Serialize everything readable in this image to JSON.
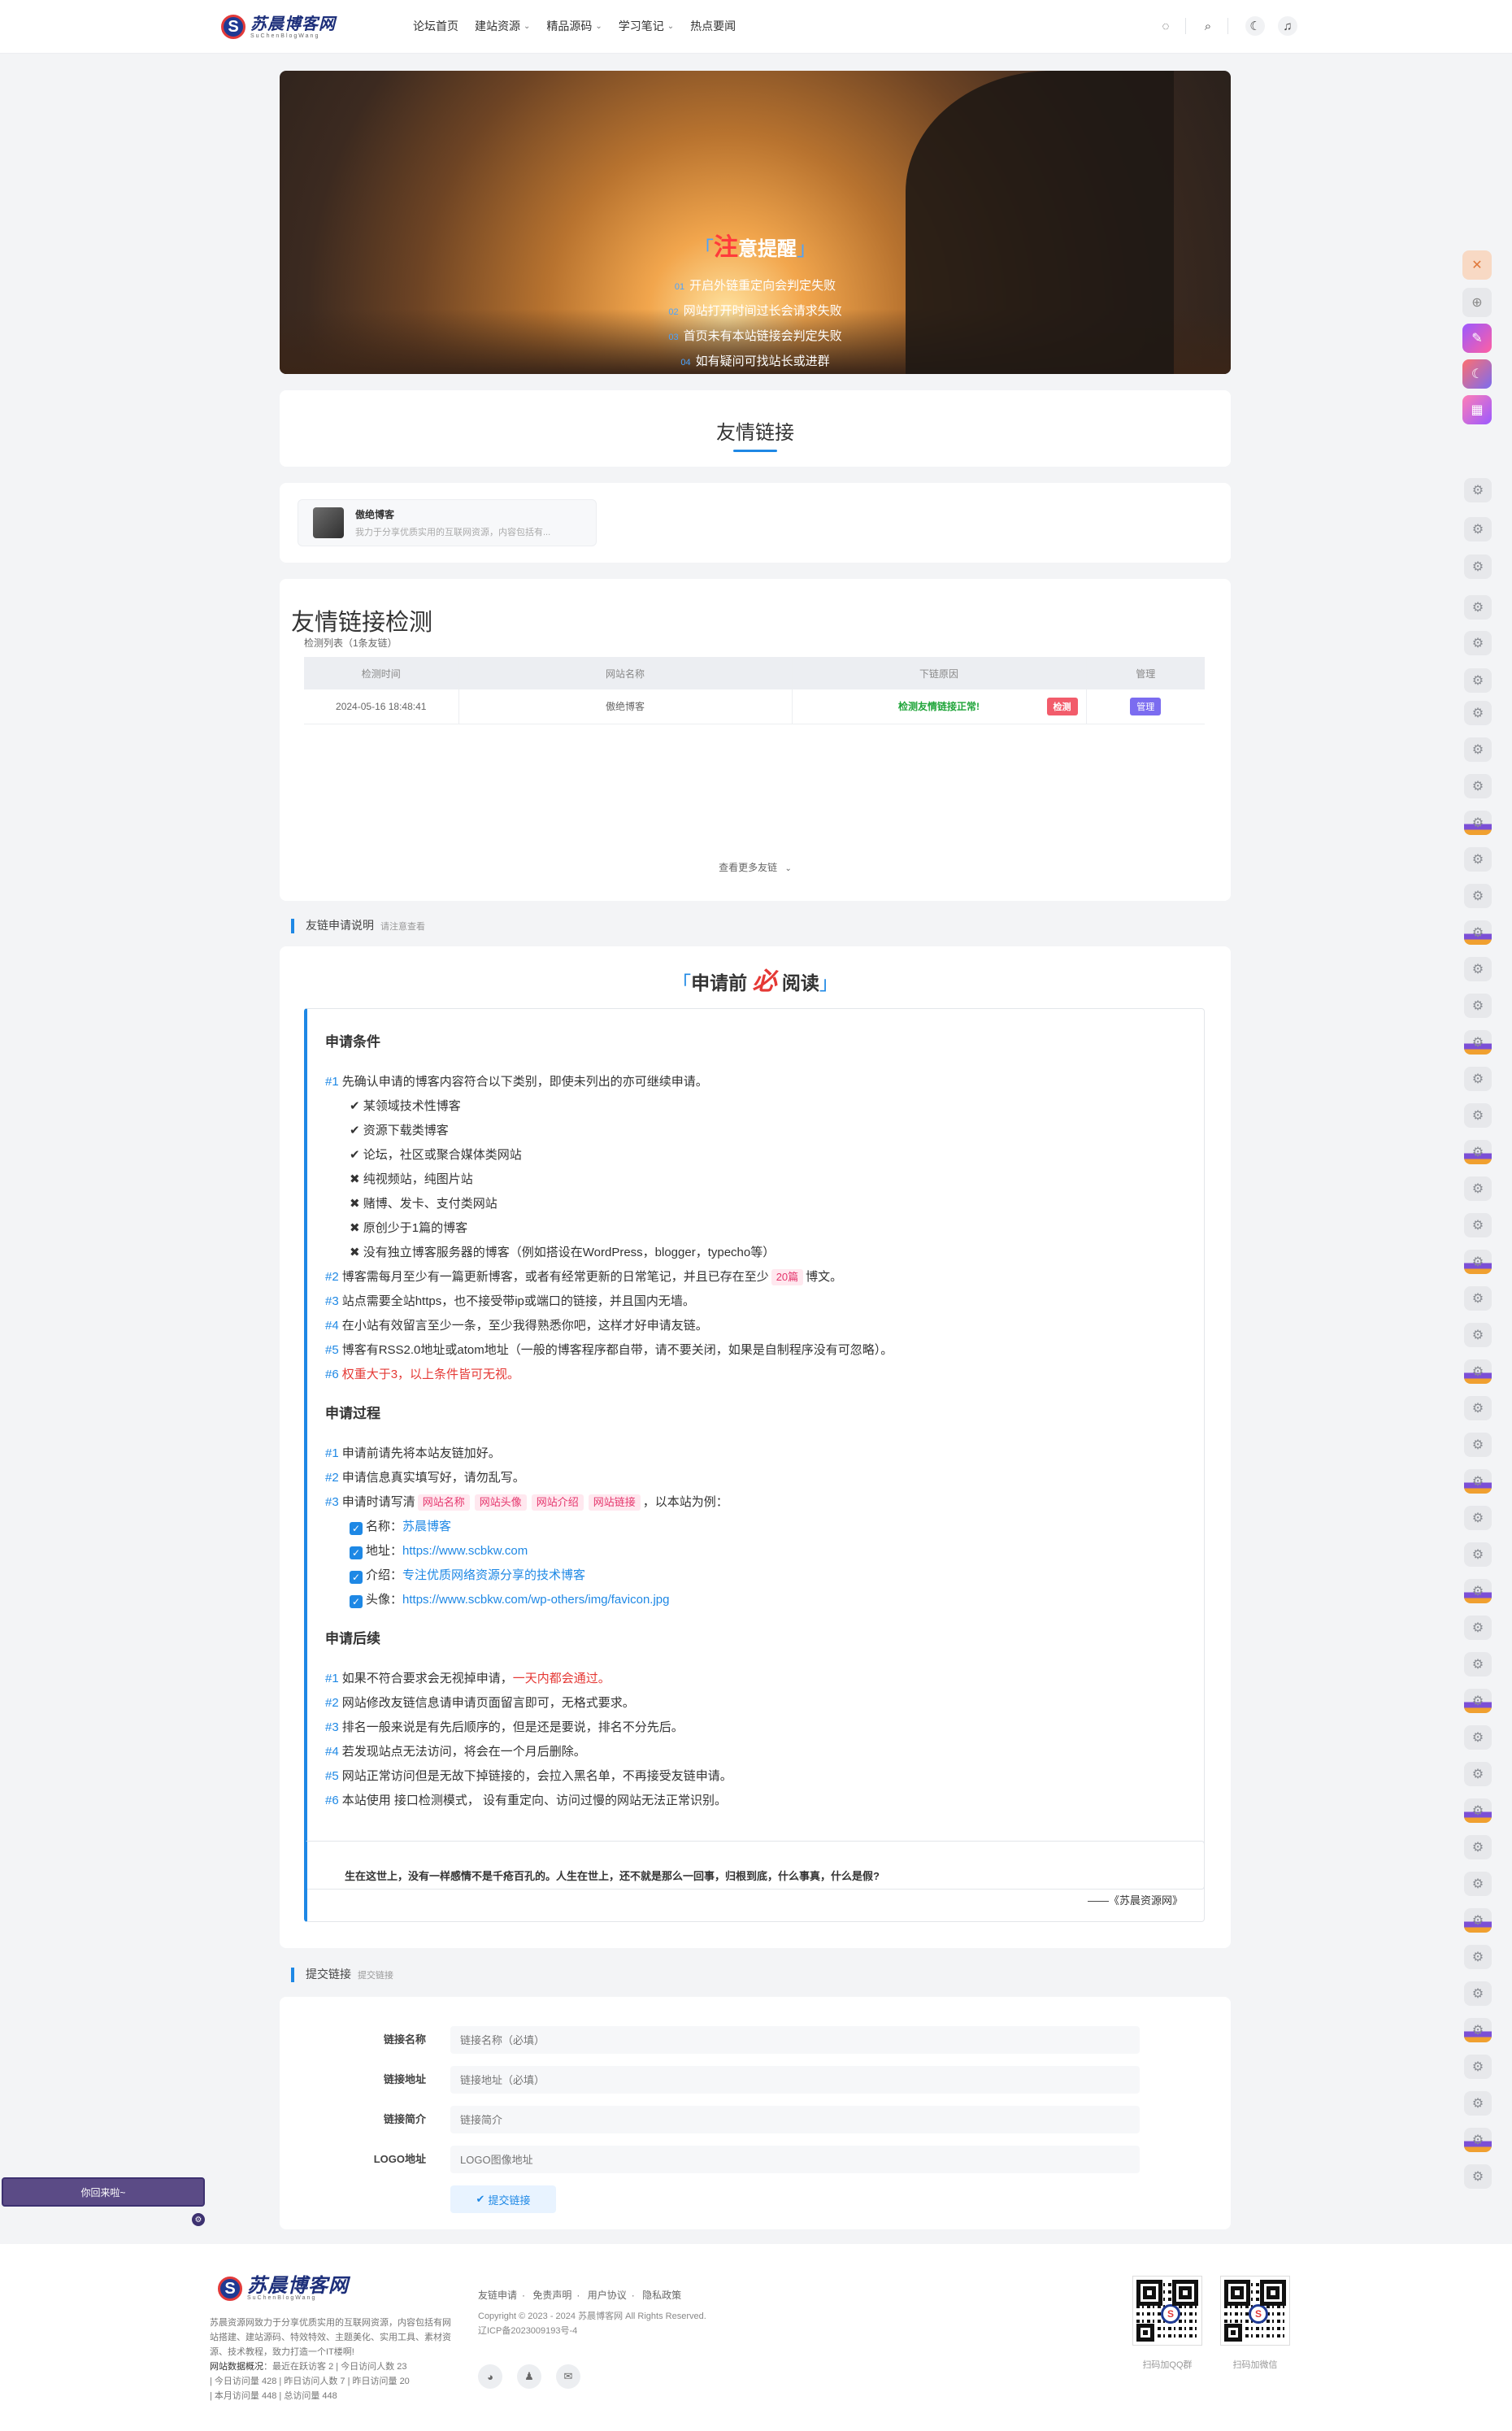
{
  "header": {
    "logo_cn": "苏晨博客网",
    "logo_en": "SuChenBlogWang",
    "nav": [
      {
        "label": "论坛首页",
        "dropdown": false
      },
      {
        "label": "建站资源",
        "dropdown": true
      },
      {
        "label": "精品源码",
        "dropdown": true
      },
      {
        "label": "学习笔记",
        "dropdown": true
      },
      {
        "label": "热点要闻",
        "dropdown": false
      }
    ]
  },
  "banner": {
    "title_big": "注",
    "title_rest": "意提醒",
    "lines": [
      {
        "num": "01",
        "text": "开启外链重定向会判定失败"
      },
      {
        "num": "02",
        "text": "网站打开时间过长会请求失败"
      },
      {
        "num": "03",
        "text": "首页未有本站链接会判定失败"
      },
      {
        "num": "04",
        "text": "如有疑问可找站长或进群"
      }
    ]
  },
  "links_section": {
    "title": "友情链接"
  },
  "friend": {
    "name": "傲绝博客",
    "desc": "我力于分享优质实用的互联网资源，内容包括有..."
  },
  "check": {
    "title": "友情链接检测",
    "subtitle": "检测列表（1条友链）",
    "headers": [
      "检测时间",
      "网站名称",
      "下链原因",
      "管理"
    ],
    "rows": [
      {
        "time": "2024-05-16 18:48:41",
        "name": "傲绝博客",
        "reason": "检测友情链接正常!",
        "btn1": "检测",
        "btn2": "管理"
      }
    ],
    "more": "查看更多友链"
  },
  "apply_label": {
    "title": "友链申请说明",
    "sub": "请注意查看"
  },
  "read": {
    "pre": "申请前",
    "must": "必",
    "post": "阅读",
    "cond_title": "申请条件",
    "cond": [
      {
        "n": "#1",
        "text": "先确认申请的博客内容符合以下类别，即使未列出的亦可继续申请。"
      }
    ],
    "cond_yes": [
      "某领域技术性博客",
      "资源下载类博客",
      "论坛，社区或聚合媒体类网站"
    ],
    "cond_no": [
      "纯视频站，纯图片站",
      "赌博、发卡、支付类网站",
      "原创少于1篇的博客",
      "没有独立博客服务器的博客（例如搭设在WordPress，blogger，typecho等）"
    ],
    "cond_more": [
      {
        "n": "#2",
        "pre": "博客需每月至少有一篇更新博客，或者有经常更新的日常笔记，并且已存在至少",
        "pill": "20篇",
        "post": "博文。"
      },
      {
        "n": "#3",
        "text": "站点需要全站https，也不接受带ip或端口的链接，并且国内无墙。"
      },
      {
        "n": "#4",
        "text": "在小站有效留言至少一条，至少我得熟悉你吧，这样才好申请友链。"
      },
      {
        "n": "#5",
        "text": "博客有RSS2.0地址或atom地址（一般的博客程序都自带，请不要关闭，如果是自制程序没有可忽略）。"
      },
      {
        "n": "#6",
        "text": "权重大于3，以上条件皆可无视。"
      }
    ],
    "proc_title": "申请过程",
    "proc": [
      {
        "n": "#1",
        "text": "申请前请先将本站友链加好。"
      },
      {
        "n": "#2",
        "text": "申请信息真实填写好，请勿乱写。"
      }
    ],
    "proc3": {
      "n": "#3",
      "pre": "申请时请写清",
      "pills": [
        "网站名称",
        "网站头像",
        "网站介绍",
        "网站链接"
      ],
      "post": "，以本站为例："
    },
    "example": [
      {
        "k": "名称：",
        "v": "苏晨博客"
      },
      {
        "k": "地址：",
        "v": "https://www.scbkw.com"
      },
      {
        "k": "介绍：",
        "v": "专注优质网络资源分享的技术博客"
      },
      {
        "k": "头像：",
        "v": "https://www.scbkw.com/wp-others/img/favicon.jpg"
      }
    ],
    "after_title": "申请后续",
    "after1": {
      "n": "#1",
      "pre": "如果不符合要求会无视掉申请，",
      "red": "一天内都会通过。"
    },
    "after": [
      {
        "n": "#2",
        "text": "网站修改友链信息请申请页面留言即可，无格式要求。"
      },
      {
        "n": "#3",
        "text": "排名一般来说是有先后顺序的，但是还是要说，排名不分先后。"
      },
      {
        "n": "#4",
        "text": "若发现站点无法访问，将会在一个月后删除。"
      },
      {
        "n": "#5",
        "text": "网站正常访问但是无故下掉链接的，会拉入黑名单，不再接受友链申请。"
      },
      {
        "n": "#6",
        "text": "本站使用 接口检测模式， 设有重定向、访问过慢的网站无法正常识别。"
      }
    ],
    "quote": "生在这世上，没有一样感情不是千疮百孔的。人生在世上，还不就是那么一回事，归根到底，什么事真，什么是假?",
    "quote_src": "——《苏晨资源网》"
  },
  "submit_label": {
    "title": "提交链接",
    "sub": "提交链接"
  },
  "form": {
    "fields": [
      {
        "label": "链接名称",
        "placeholder": "链接名称（必填）"
      },
      {
        "label": "链接地址",
        "placeholder": "链接地址（必填）"
      },
      {
        "label": "链接简介",
        "placeholder": "链接简介"
      },
      {
        "label": "LOGO地址",
        "placeholder": "LOGO图像地址"
      }
    ],
    "submit": "提交链接"
  },
  "widget": {
    "greet": "你回来啦~"
  },
  "footer": {
    "desc": "苏晨资源网致力于分享优质实用的互联网资源，内容包括有网站搭建、建站源码、特效特效、主题美化、实用工具、素材资源、技术教程，致力打造一个IT楼啊!",
    "stats_label": "网站数据概况 · 最近在跃访客",
    "stats": [
      {
        "k": "最近在跃访客",
        "v": "2"
      },
      {
        "k": "今日访问人数",
        "v": "23"
      },
      {
        "k": "今日访问量",
        "v": "428"
      },
      {
        "k": "昨日访问人数",
        "v": "7"
      },
      {
        "k": "昨日访问量",
        "v": "20"
      },
      {
        "k": "本月访问量",
        "v": "448"
      },
      {
        "k": "总访问量",
        "v": "448"
      }
    ],
    "links": [
      "友链申请",
      "免责声明",
      "用户协议",
      "隐私政策"
    ],
    "copyright": "Copyright © 2023 - 2024 苏晨博客网 All Rights Reserved.",
    "icp": "辽ICP备2023009193号-4",
    "qr1_cap": "扫码加QQ群",
    "qr2_cap": "扫码加微信"
  }
}
